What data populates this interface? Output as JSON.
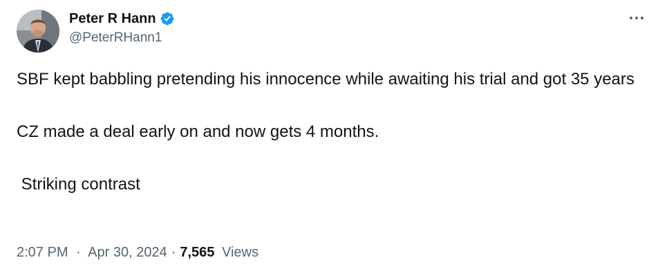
{
  "author": {
    "display_name": "Peter R Hann",
    "handle": "@PeterRHann1",
    "verified_icon": "verified-badge-icon",
    "avatar_icon": "profile-photo"
  },
  "tweet": {
    "text": "SBF kept babbling pretending his innocence while awaiting his trial and got 35 years\n\nCZ made a deal early on and now gets 4 months.\n\n Striking contrast"
  },
  "meta": {
    "time": "2:07 PM",
    "separator": "·",
    "date": "Apr 30, 2024",
    "views_count": "7,565",
    "views_label": "Views"
  },
  "colors": {
    "verified_blue": "#1d9bf0",
    "secondary_text": "#536471",
    "primary_text": "#0f1419"
  },
  "icons": {
    "more": "more-options-icon"
  }
}
